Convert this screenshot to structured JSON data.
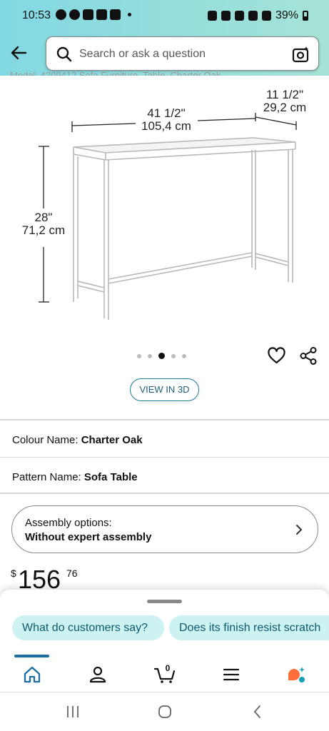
{
  "status_bar": {
    "time": "10:53",
    "battery": "39%"
  },
  "header": {
    "back_icon": "back-arrow-icon",
    "search_placeholder": "Search or ask a question",
    "camera_icon": "camera-search-icon"
  },
  "partial_text": "Model: 4209412 Sofa Furniture, Table, Charter Oak",
  "product_image": {
    "dimensions": {
      "width_in": "41 1/2\"",
      "width_cm": "105,4 cm",
      "depth_in": "11 1/2\"",
      "depth_cm": "29,2 cm",
      "height_in": "28\"",
      "height_cm": "71,2 cm"
    },
    "carousel": {
      "count": 5,
      "active_index": 2
    }
  },
  "actions": {
    "wishlist_icon": "heart-icon",
    "share_icon": "share-icon",
    "view_3d_label": "VIEW IN 3D"
  },
  "attributes": [
    {
      "label": "Colour Name:",
      "value": "Charter Oak"
    },
    {
      "label": "Pattern Name:",
      "value": "Sofa Table"
    }
  ],
  "assembly": {
    "title": "Assembly options:",
    "value": "Without expert assembly"
  },
  "price": {
    "symbol": "$",
    "whole": "156",
    "fraction": "76"
  },
  "bottom_sheet": {
    "chips": [
      "What do customers say?",
      "Does its finish resist scratch"
    ]
  },
  "bottom_nav": {
    "items": [
      "home-icon",
      "account-icon",
      "cart-icon",
      "menu-icon",
      "rufus-icon"
    ],
    "cart_count": "0",
    "colors": {
      "active": "#1f6da5",
      "accent": "#ff6f3c",
      "rufus": "#14a0b4"
    }
  },
  "system_nav": [
    "recents-icon",
    "home-circle-icon",
    "back-chevron-icon"
  ],
  "colors": {
    "header_gradient_start": "#82d8e3",
    "header_gradient_end": "#a6e3d6",
    "chip_bg": "#ccf3f1",
    "link": "#1b5f79"
  }
}
